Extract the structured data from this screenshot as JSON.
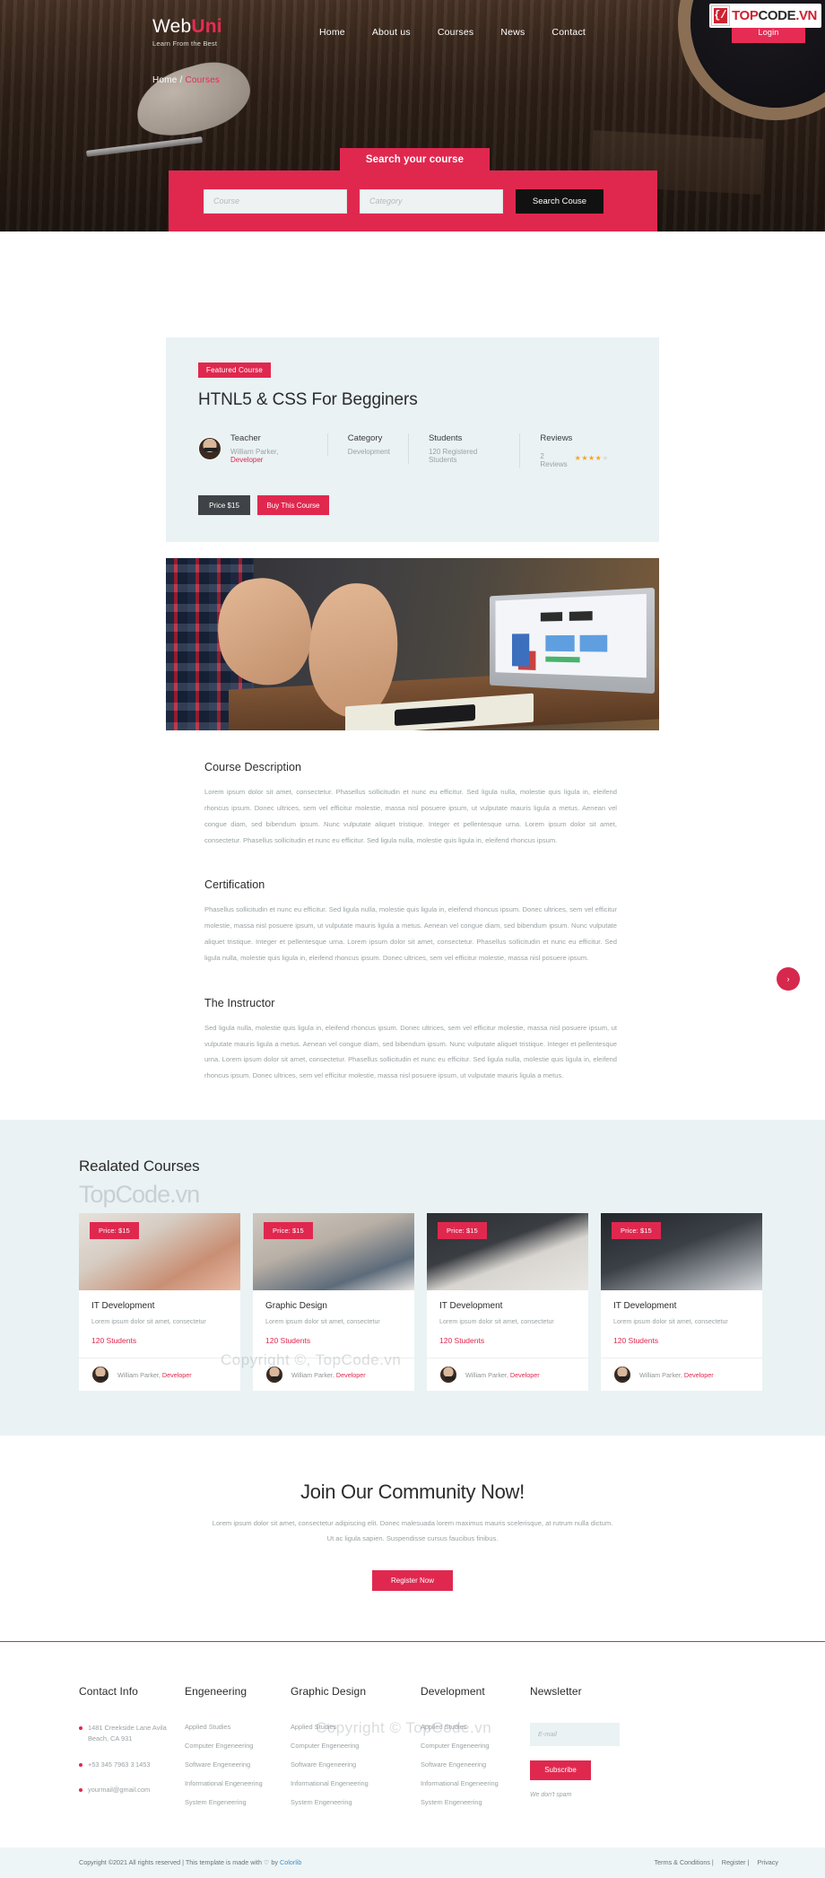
{
  "header": {
    "brand_main": "Web",
    "brand_accent": "Uni",
    "brand_tagline": "Learn From the Best",
    "nav": [
      {
        "label": "Home"
      },
      {
        "label": "About us"
      },
      {
        "label": "Courses"
      },
      {
        "label": "News"
      },
      {
        "label": "Contact"
      }
    ],
    "login_label": "Login",
    "watermark_logo": {
      "mark": "{/}",
      "t1": "TOP",
      "t2": "CODE",
      "t3": ".VN"
    }
  },
  "breadcrumb": {
    "home": "Home",
    "separator": "/",
    "current": "Courses"
  },
  "search": {
    "tab_label": "Search your course",
    "course_placeholder": "Course",
    "category_placeholder": "Category",
    "button_label": "Search Couse"
  },
  "course": {
    "badge": "Featured Course",
    "title": "HTNL5 & CSS For Begginers",
    "meta": [
      {
        "label": "Teacher",
        "value": "William Parker, ",
        "accent": "Developer"
      },
      {
        "label": "Category",
        "value": "Development"
      },
      {
        "label": "Students",
        "value": "120 Registered Students"
      },
      {
        "label": "Reviews",
        "value": "2 Reviews",
        "rating": 4,
        "max": 5
      }
    ],
    "price_label": "Price $15",
    "buy_label": "Buy This Course"
  },
  "sections": [
    {
      "heading": "Course Description",
      "body": "Lorem ipsum dolor sit amet, consectetur. Phasellus sollicitudin et nunc eu efficitur. Sed ligula nulla, molestie quis ligula in, eleifend rhoncus ipsum. Donec ultrices, sem vel efficitur molestie, massa nisl posuere ipsum, ut vulputate mauris ligula a metus. Aenean vel congue diam, sed bibendum ipsum. Nunc vulputate aliquet tristique. Integer et pellentesque urna. Lorem ipsum dolor sit amet, consectetur. Phasellus sollicitudin et nunc eu efficitur. Sed ligula nulla, molestie quis ligula in, eleifend rhoncus ipsum."
    },
    {
      "heading": "Certification",
      "body": "Phasellus sollicitudin et nunc eu efficitur. Sed ligula nulla, molestie quis ligula in, eleifend rhoncus ipsum. Donec ultrices, sem vel efficitur molestie, massa nisl posuere ipsum, ut vulputate mauris ligula a metus. Aenean vel congue diam, sed bibendum ipsum. Nunc vulputate aliquet tristique. Integer et pellentesque urna. Lorem ipsum dolor sit amet, consectetur. Phasellus sollicitudin et nunc eu efficitur. Sed ligula nulla, molestie quis ligula in, eleifend rhoncus ipsum. Donec ultrices, sem vel efficitur molestie, massa nisl posuere ipsum."
    },
    {
      "heading": "The Instructor",
      "body": "Sed ligula nulla, molestie quis ligula in, eleifend rhoncus ipsum. Donec ultrices, sem vel efficitur molestie, massa nisl posuere ipsum, ut vulputate mauris ligula a metus. Aenean vel congue diam, sed bibendum ipsum. Nunc vulputate aliquet tristique. Integer et pellentesque urna. Lorem ipsum dolor sit amet, consectetur. Phasellus sollicitudin et nunc eu efficitur. Sed ligula nulla, molestie quis ligula in, eleifend rhoncus ipsum. Donec ultrices, sem vel efficitur molestie, massa nisl posuere ipsum, ut vulputate mauris ligula a metus."
    }
  ],
  "related": {
    "heading": "Realated Courses",
    "watermark": "TopCode.vn",
    "next_icon": "›",
    "cards": [
      {
        "price": "Price: $15",
        "title": "IT Development",
        "desc": "Lorem ipsum dolor sit amet, consectetur",
        "students": "120 Students",
        "author": "William Parker, ",
        "role": "Developer"
      },
      {
        "price": "Price: $15",
        "title": "Graphic Design",
        "desc": "Lorem ipsum dolor sit amet, consectetur",
        "students": "120 Students",
        "author": "William Parker, ",
        "role": "Developer"
      },
      {
        "price": "Price: $15",
        "title": "IT Development",
        "desc": "Lorem ipsum dolor sit amet, consectetur",
        "students": "120 Students",
        "author": "William Parker, ",
        "role": "Developer"
      },
      {
        "price": "Price: $15",
        "title": "IT Development",
        "desc": "Lorem ipsum dolor sit amet, consectetur",
        "students": "120 Students",
        "author": "William Parker, ",
        "role": "Developer"
      }
    ]
  },
  "community": {
    "heading": "Join Our Community Now!",
    "body": "Lorem ipsum dolor sit amet, consectetur adipiscing elit. Donec malesuada lorem maximus mauris scelerisque, at rutrum nulla dictum. Ut ac ligula sapien. Suspendisse cursus faucibus finibus.",
    "button": "Register Now"
  },
  "footer": {
    "contact": {
      "heading": "Contact Info",
      "address": "1481 Creekside Lane Avila Beach, CA 931",
      "phone": "+53 345 7963 3 1453",
      "email": "yourmail@gmail.com"
    },
    "columns": [
      {
        "heading": "Engeneering",
        "links": [
          "Applied Studies",
          "Computer Engeneering",
          "Software Engeneering",
          "Informational Engeneering",
          "System Engeneering"
        ]
      },
      {
        "heading": "Graphic Design",
        "links": [
          "Applied Studies",
          "Computer Engeneering",
          "Software Engeneering",
          "Informational Engeneering",
          "System Engeneering"
        ]
      },
      {
        "heading": "Development",
        "links": [
          "Applied Studies",
          "Computer Engeneering",
          "Software Engeneering",
          "Informational Engeneering",
          "System Engeneering"
        ]
      }
    ],
    "newsletter": {
      "heading": "Newsletter",
      "placeholder": "E-mail",
      "button": "Subscribe",
      "note": "We don't spam"
    },
    "copyright_text": "Copyright ©2021 All rights reserved | This template is made with ♡ by ",
    "copyright_link": "Colorlib",
    "legal": [
      {
        "label": "Terms & Conditions |"
      },
      {
        "label": "Register |"
      },
      {
        "label": "Privacy"
      }
    ]
  },
  "watermarks": {
    "copy1": "Copyright ©, TopCode.vn",
    "copy2": "Copyright © TopCode.vn"
  },
  "colors": {
    "accent": "#e0284f",
    "dark": "#2b2b2b",
    "muted": "#9aa2a4",
    "panel": "#eaf2f4"
  }
}
